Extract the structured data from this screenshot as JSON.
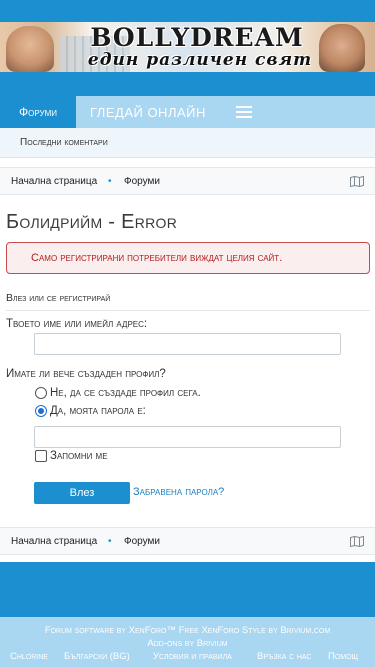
{
  "banner": {
    "title": "BOLLYDREAM",
    "subtitle": "един различен свят"
  },
  "nav": {
    "forums_tab": "Форуми",
    "watch_online": "ГЛЕДАЙ ОНЛАЙН",
    "latest_comments": "Последни коментари"
  },
  "breadcrumb": {
    "home": "Начална страница",
    "separator": "•",
    "forums": "Форуми"
  },
  "page": {
    "title": "Болидрийм - Error"
  },
  "error": {
    "message": "Само регистрирани потребители виждат целия сайт."
  },
  "login": {
    "section_title": "Влез или се регистрирай",
    "username_label": "Твоето име или имейл адрес:",
    "username_value": "",
    "have_account_label": "Имате ли вече създаден профил?",
    "option_no": "Не, да се създаде профил сега.",
    "option_yes": "Да, моята парола е:",
    "password_value": "",
    "remember_me": "Запомни ме",
    "login_button": "Влез",
    "forgot_password": "Забравена парола?"
  },
  "footer": {
    "credits": "Forum software by XenForo™ Free XenForo Style by Brivium.com",
    "addons": "Add-ons by Brivium",
    "links": [
      "Chlorine",
      "Български (BG)",
      "Условия и правила",
      "Връзка с нас",
      "Помощ"
    ]
  },
  "colors": {
    "primary": "#1c8fd0",
    "nav_light": "#a9d6f0",
    "error": "#b01c1c"
  }
}
